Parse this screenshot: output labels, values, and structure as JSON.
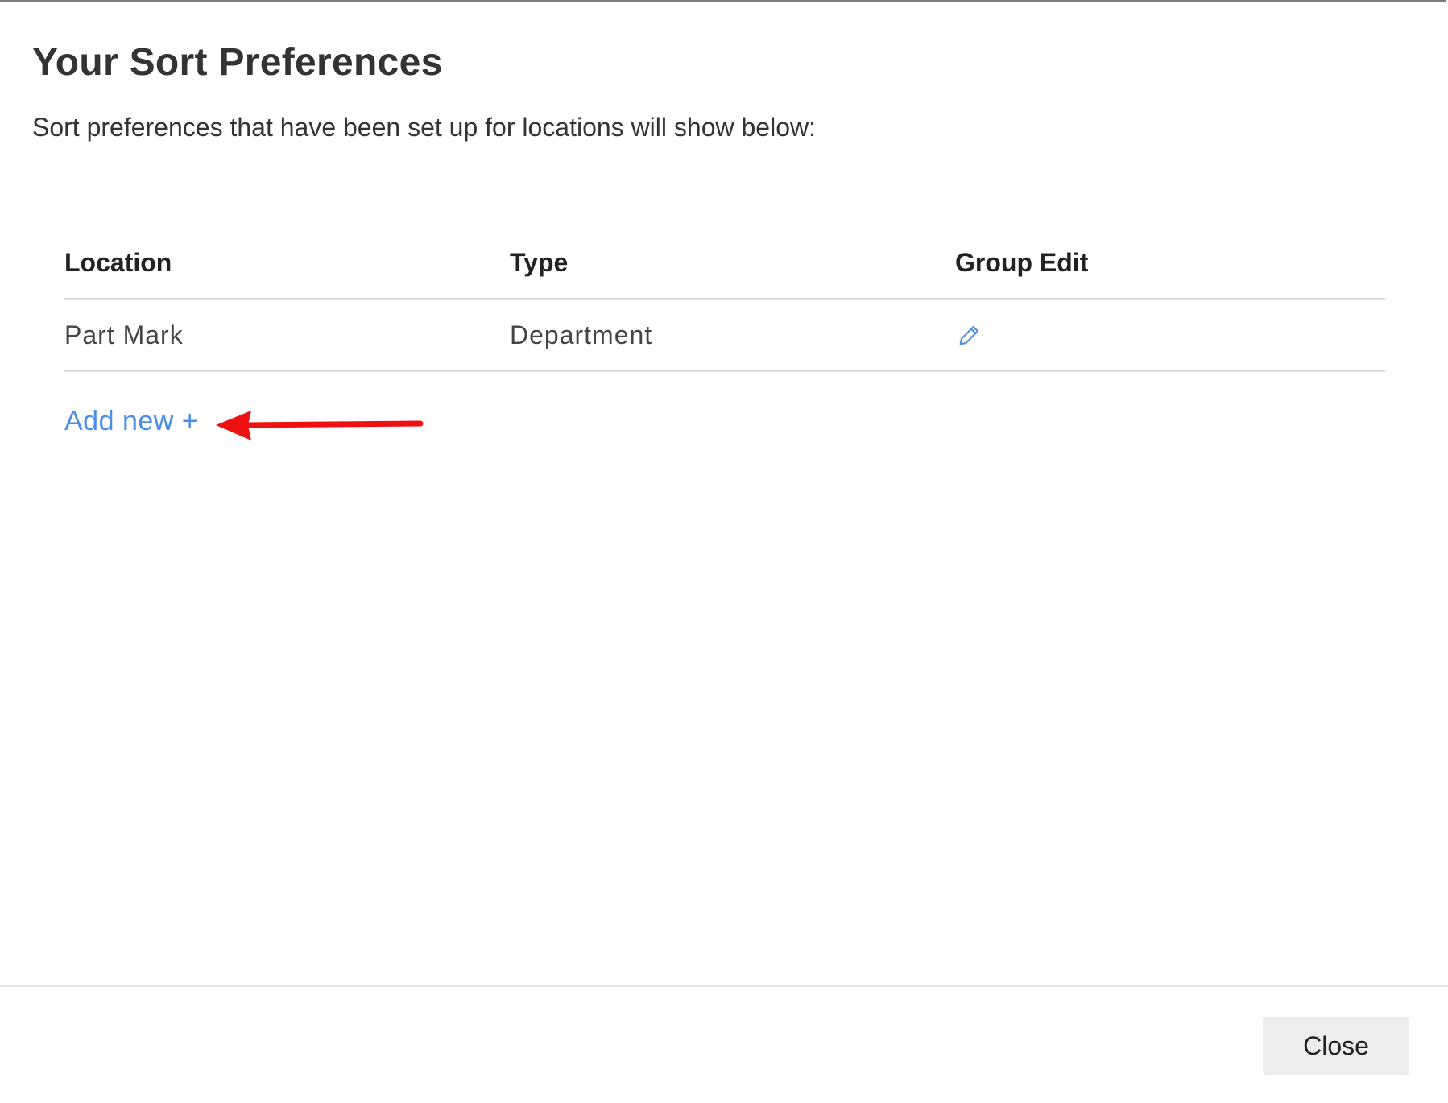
{
  "dialog": {
    "title": "Your Sort Preferences",
    "subtitle": "Sort preferences that have been set up for locations will show below:"
  },
  "table": {
    "columns": [
      "Location",
      "Type",
      "Group Edit"
    ],
    "rows": [
      {
        "location": "Part Mark",
        "type": "Department",
        "edit_icon": "pencil-icon"
      }
    ]
  },
  "actions": {
    "add_new_label": "Add new +",
    "close_label": "Close"
  },
  "annotation": {
    "arrow_color": "#ee1111",
    "arrow_direction": "left"
  },
  "colors": {
    "link": "#4a8ee8",
    "text": "#333333",
    "divider": "#dcdcdc",
    "button_bg": "#ededed"
  }
}
